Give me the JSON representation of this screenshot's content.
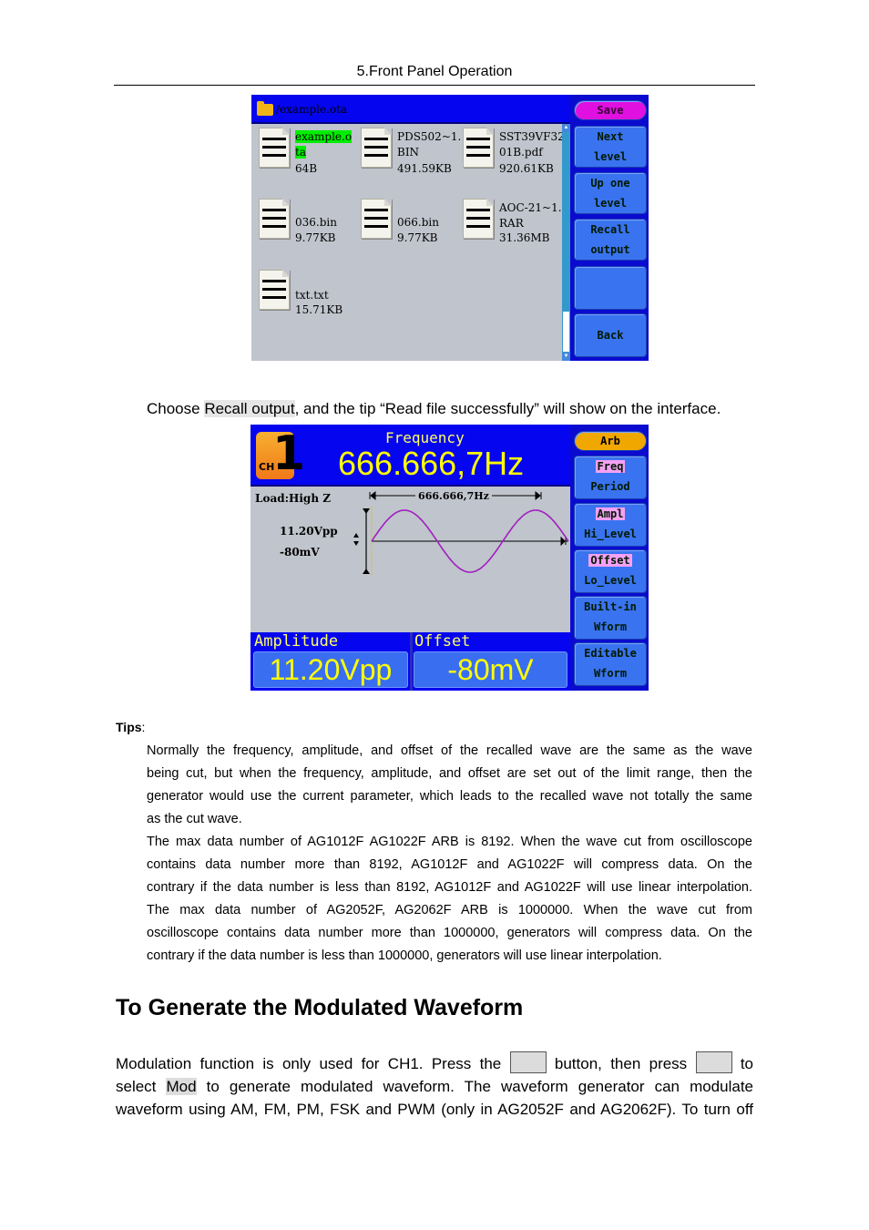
{
  "page_header": "5.Front Panel Operation",
  "file_browser": {
    "path": "/example.ota",
    "files": [
      {
        "name_selected": "example.o",
        "name_selected2": "ta",
        "name_rest": "",
        "size": "64B",
        "selected": true
      },
      {
        "name": "PDS502~1.BIN",
        "size": "491.59KB"
      },
      {
        "name": "SST39VF3201B.pdf",
        "size": "920.61KB"
      },
      {
        "name": "036.bin",
        "size": "9.77KB"
      },
      {
        "name": "066.bin",
        "size": "9.77KB"
      },
      {
        "name": "AOC-21~1.RAR",
        "size": "31.36MB"
      },
      {
        "name": "txt.txt",
        "size": "15.71KB"
      }
    ],
    "menu": {
      "save": "Save",
      "next_level": [
        "Next",
        "level"
      ],
      "up_one_level": [
        "Up one",
        "level"
      ],
      "recall_output": [
        "Recall",
        "output"
      ],
      "empty": "",
      "back": "Back"
    }
  },
  "caption": {
    "before": "Choose ",
    "highlight": "Recall output",
    "after": ", and the tip “Read file successfully” will show on the interface."
  },
  "generator": {
    "channel_label": "CH",
    "channel_number": "1",
    "frequency_label": "Frequency",
    "frequency_value": "666.666,7Hz",
    "load": "Load:High Z",
    "amp_small": "11.20Vpp",
    "offset_small": "-80mV",
    "period_label": "666.666,7Hz",
    "amplitude_label": "Amplitude",
    "amplitude_value": "11.20Vpp",
    "offset_label": "Offset",
    "offset_value": "-80mV",
    "wave": {
      "type": "sine",
      "cycles": 1.5,
      "color": "#a020c0"
    },
    "menu": {
      "arb": "Arb",
      "freq": "Freq",
      "period": "Period",
      "ampl": "Ampl",
      "hi_level": "Hi_Level",
      "offset": "Offset",
      "lo_level": "Lo_Level",
      "builtin": "Built-in",
      "builtin2": "Wform",
      "editable": "Editable",
      "editable2": "Wform"
    }
  },
  "tips": {
    "heading": "Tips",
    "colon": ":",
    "p1": [
      "Normally the frequency, amplitude, and offset of the recalled wave are the same as the wave",
      "being cut, but when the frequency, amplitude, and offset are set out of the limit range, then the",
      "generator would use the current parameter, which leads to the recalled wave not totally the same",
      "as the cut wave."
    ],
    "p2": [
      "The max data number of AG1012F AG1022F ARB is 8192. When the wave cut from oscilloscope",
      "contains data number more than 8192, AG1012F and AG1022F will compress data. On the",
      "contrary if the data number is less than 8192, AG1012F and AG1022F will use linear interpolation.",
      "The max data number of AG2052F, AG2062F ARB is 1000000. When the wave cut from",
      "oscilloscope contains data number more than 1000000, generators will compress data. On the",
      "contrary if the data number is less than 1000000, generators will use linear interpolation."
    ]
  },
  "section": {
    "heading": "To Generate the Modulated Waveform",
    "l1a": "Modulation function is only used for CH1. Press the ",
    "l1b": " button, then press ",
    "l1c": " to",
    "l2a": "select ",
    "l2hi": "Mod",
    "l2b": " to generate modulated waveform. The waveform generator can modulate",
    "l3": "waveform using AM, FM, PM, FSK and PWM (only in AG2052F and AG2062F). To turn off"
  }
}
